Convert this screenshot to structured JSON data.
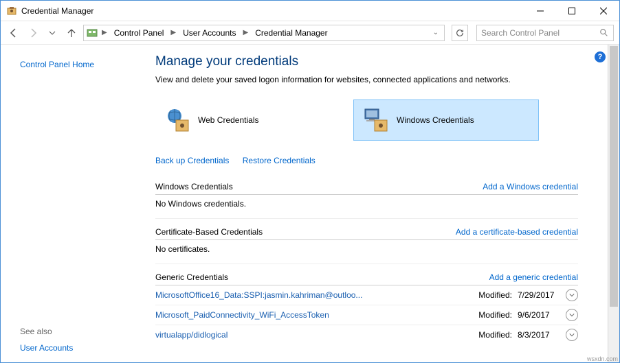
{
  "window": {
    "title": "Credential Manager"
  },
  "nav": {
    "crumbs": [
      "Control Panel",
      "User Accounts",
      "Credential Manager"
    ],
    "searchPlaceholder": "Search Control Panel"
  },
  "sidebar": {
    "home": "Control Panel Home",
    "seeAlsoLabel": "See also",
    "seeAlsoLink": "User Accounts"
  },
  "main": {
    "heading": "Manage your credentials",
    "desc": "View and delete your saved logon information for websites, connected applications and networks.",
    "credTypes": {
      "web": "Web Credentials",
      "windows": "Windows Credentials"
    },
    "actions": {
      "backup": "Back up Credentials",
      "restore": "Restore Credentials"
    },
    "sections": {
      "winCred": {
        "title": "Windows Credentials",
        "addLink": "Add a Windows credential",
        "empty": "No Windows credentials."
      },
      "certCred": {
        "title": "Certificate-Based Credentials",
        "addLink": "Add a certificate-based credential",
        "empty": "No certificates."
      },
      "genCred": {
        "title": "Generic Credentials",
        "addLink": "Add a generic credential",
        "modifiedLabel": "Modified:",
        "items": [
          {
            "name": "MicrosoftOffice16_Data:SSPI:jasmin.kahriman@outloo...",
            "date": "7/29/2017"
          },
          {
            "name": "Microsoft_PaidConnectivity_WiFi_AccessToken",
            "date": "9/6/2017"
          },
          {
            "name": "virtualapp/didlogical",
            "date": "8/3/2017"
          }
        ]
      }
    }
  },
  "footerBrand": "wsxdn.com"
}
